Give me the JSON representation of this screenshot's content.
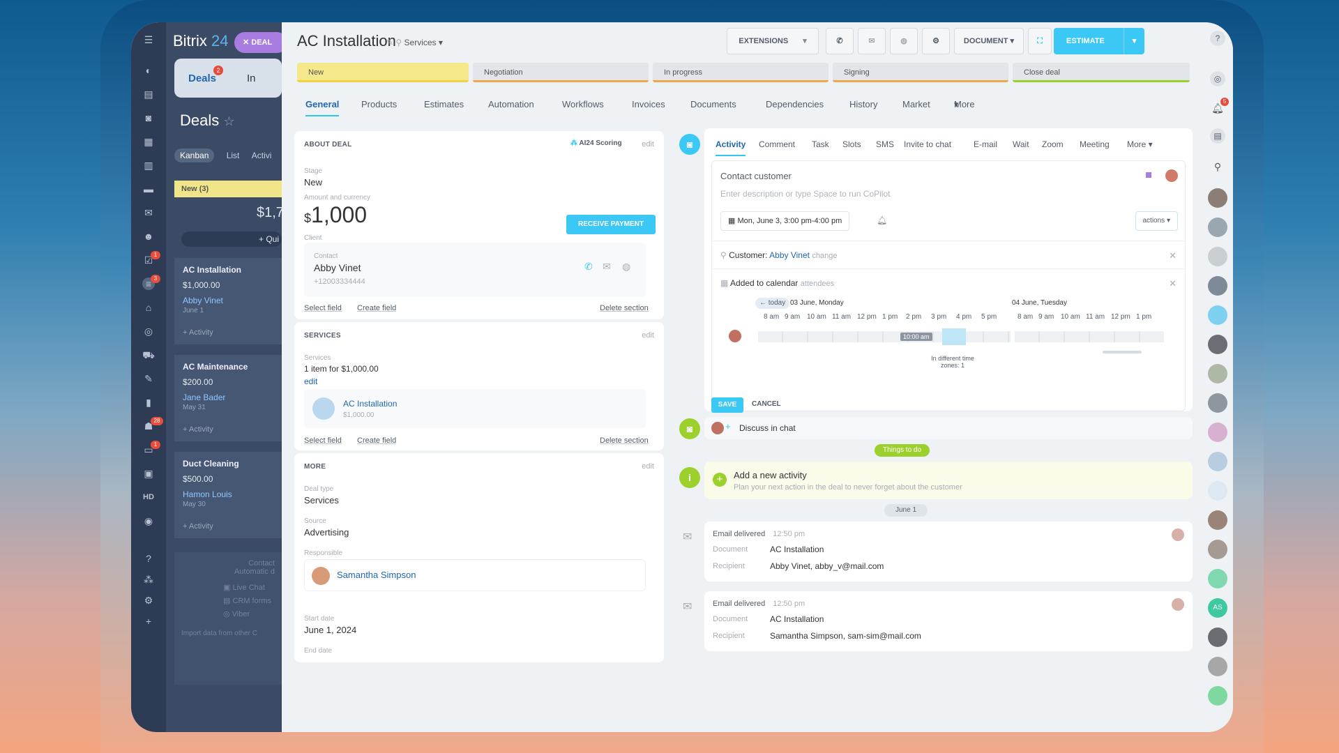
{
  "app": {
    "brand_a": "Bitrix",
    "brand_b": "24",
    "deal_chip": "DEAL"
  },
  "crm": {
    "tab_deals": "Deals",
    "tab_deals_badge": "2",
    "tab_in": "In",
    "section_title": "Deals",
    "views": [
      "Kanban",
      "List",
      "Activi"
    ],
    "column_new": "New",
    "column_new_count": "(3)",
    "sum": "$1,7",
    "quick": "+ Qui",
    "cards": [
      {
        "name": "AC Installation",
        "amount": "$1,000.00",
        "person": "Abby Vinet",
        "date": "June 1",
        "activity": "+ Activity"
      },
      {
        "name": "AC Maintenance",
        "amount": "$200.00",
        "person": "Jane Bader",
        "date": "May 31",
        "activity": "+ Activity"
      },
      {
        "name": "Duct Cleaning",
        "amount": "$500.00",
        "person": "Hamon Louis",
        "date": "May 30",
        "activity": "+ Activity"
      }
    ],
    "bottom": {
      "contact": "Contact",
      "auto": "Automatic d",
      "live": "Live Chat",
      "forms": "CRM forms",
      "viber": "Viber",
      "import": "Import data from other C"
    }
  },
  "leftbar": {
    "badges": [
      "1",
      "3",
      "28",
      "1"
    ],
    "hd": "HD"
  },
  "header": {
    "title": "AC Installation",
    "category": "Services",
    "extensions": "EXTENSIONS",
    "document": "DOCUMENT",
    "estimate": "ESTIMATE"
  },
  "stages": [
    "New",
    "Negotiation",
    "In progress",
    "Signing",
    "Close deal"
  ],
  "tabs": [
    "General",
    "Products",
    "Estimates",
    "Automation",
    "Workflows",
    "Invoices",
    "Documents",
    "Dependencies",
    "History",
    "Market",
    "More"
  ],
  "about": {
    "heading": "ABOUT DEAL",
    "scoring": "AI24 Scoring",
    "edit": "edit",
    "stage_label": "Stage",
    "stage_value": "New",
    "amount_label": "Amount and currency",
    "currency": "$",
    "amount": "1,000",
    "receive_payment": "RECEIVE PAYMENT",
    "client_label": "Client",
    "contact_label": "Contact",
    "contact_name": "Abby Vinet",
    "contact_phone": "+12003334444",
    "select_field": "Select field",
    "create_field": "Create field",
    "delete_section": "Delete section"
  },
  "services": {
    "heading": "SERVICES",
    "edit": "edit",
    "label": "Services",
    "summary": "1 item for $1,000.00",
    "summary_edit": "edit",
    "item_name": "AC Installation",
    "item_price": "$1,000.00",
    "select_field": "Select field",
    "create_field": "Create field",
    "delete_section": "Delete section"
  },
  "more": {
    "heading": "MORE",
    "edit": "edit",
    "deal_type_label": "Deal type",
    "deal_type": "Services",
    "source_label": "Source",
    "source": "Advertising",
    "responsible_label": "Responsible",
    "responsible": "Samantha Simpson",
    "start_label": "Start date",
    "start": "June 1, 2024",
    "end_label": "End date"
  },
  "activity": {
    "tabs": [
      "Activity",
      "Comment",
      "Task",
      "Slots",
      "SMS",
      "Invite to chat",
      "E-mail",
      "Wait",
      "Zoom",
      "Meeting",
      "More"
    ],
    "title_text": "Contact customer",
    "placeholder": "Enter description or type Space to run CoPilot",
    "datetime": "Mon, June 3, 3:00 pm-4:00 pm",
    "actions": "actions",
    "customer_label": "Customer:",
    "customer_name": "Abby Vinet",
    "customer_change": "change",
    "calendar_label": "Added to calendar",
    "calendar_attendees": "attendees",
    "today": "today",
    "day1": "03 June, Monday",
    "day2": "04 June, Tuesday",
    "hours1": [
      "8 am",
      "9 am",
      "10 am",
      "11 am",
      "12 pm",
      "1 pm",
      "2 pm",
      "3 pm",
      "4 pm",
      "5 pm"
    ],
    "hours2": [
      "8 am",
      "9 am",
      "10 am",
      "11 am",
      "12 pm",
      "1 pm"
    ],
    "slot_marker": "10:00 am",
    "timezones": "In different time zones: 1",
    "save": "SAVE",
    "cancel": "CANCEL"
  },
  "discuss": "Discuss in chat",
  "todo_badge": "Things to do",
  "new_activity": {
    "title": "Add a new activity",
    "hint": "Plan your next action in the deal to never forget about the customer"
  },
  "date_sep": "June 1",
  "emails": [
    {
      "title": "Email delivered",
      "time": "12:50 pm",
      "doc_label": "Document",
      "doc": "AC Installation",
      "rec_label": "Recipient",
      "rec": "Abby Vinet, abby_v@mail.com"
    },
    {
      "title": "Email delivered",
      "time": "12:50 pm",
      "doc_label": "Document",
      "doc": "AC Installation",
      "rec_label": "Recipient",
      "rec": "Samantha Simpson, sam-sim@mail.com"
    }
  ],
  "right_rail": {
    "badge": "5",
    "initials": "AS"
  },
  "colors": {
    "accent": "#3bc8f5",
    "link": "#2067b0",
    "stage_new": "#f5e88a",
    "green": "#9bd02d"
  }
}
